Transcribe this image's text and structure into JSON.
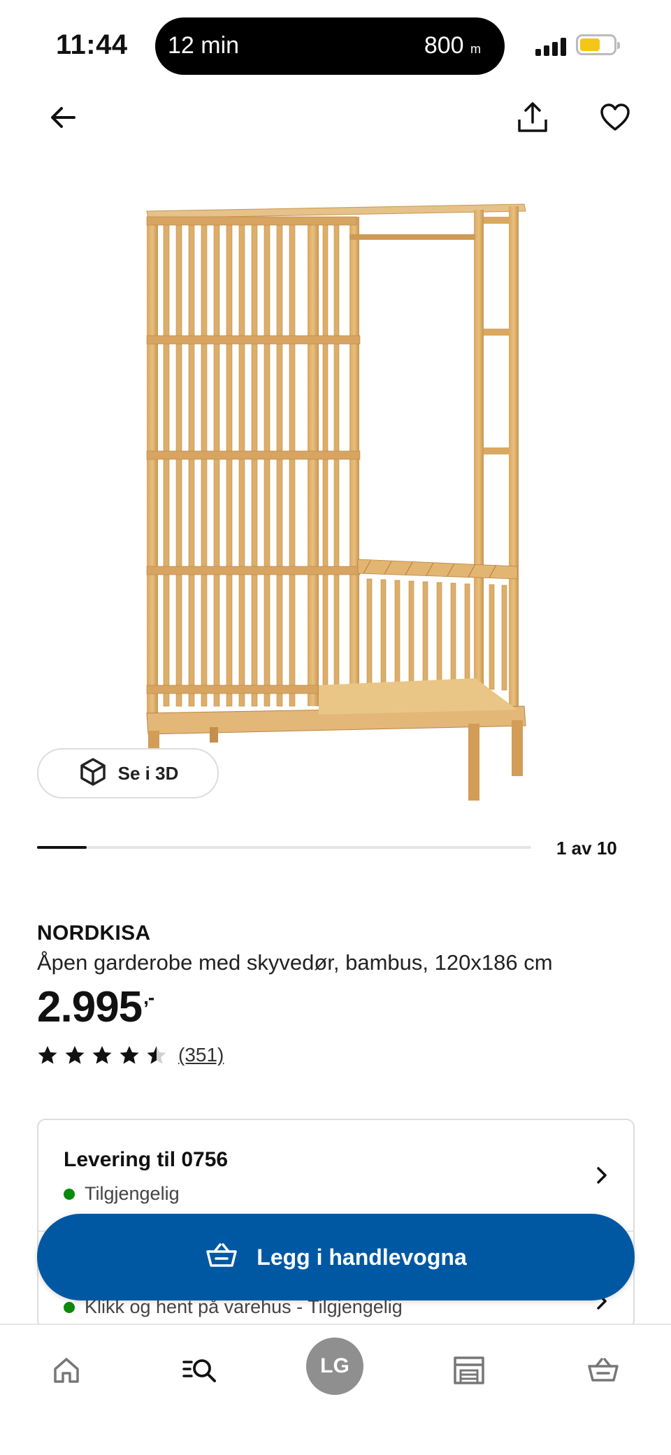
{
  "status_bar": {
    "time": "11:44",
    "activity_left": "12 min",
    "activity_right_value": "800",
    "activity_right_unit": "m",
    "battery_color": "#f5c518"
  },
  "top_nav": {
    "back_icon": "arrow-left-icon",
    "share_icon": "share-icon",
    "favorite_icon": "heart-icon"
  },
  "gallery": {
    "view_3d_label": "Se i 3D",
    "counter": "1 av 10",
    "current_index": 1,
    "total": 10
  },
  "product": {
    "name": "NORDKISA",
    "description": "Åpen garderobe med skyvedør, bambus, 120x186 cm",
    "price": "2.995",
    "price_suffix": ",-",
    "rating": 4.5,
    "review_count": "(351)"
  },
  "delivery": {
    "title": "Levering til 0756",
    "status": "Tilgjengelig",
    "status_color": "#0a8a0a"
  },
  "pickup": {
    "status": "Klikk og hent på varehus - Tilgjengelig"
  },
  "cart_button": {
    "label": "Legg i handlevogna",
    "color": "#0058a3"
  },
  "tab_bar": {
    "home_icon": "home-icon",
    "search_icon": "search-icon",
    "profile_initials": "LG",
    "store_icon": "store-icon",
    "cart_icon": "basket-icon"
  }
}
